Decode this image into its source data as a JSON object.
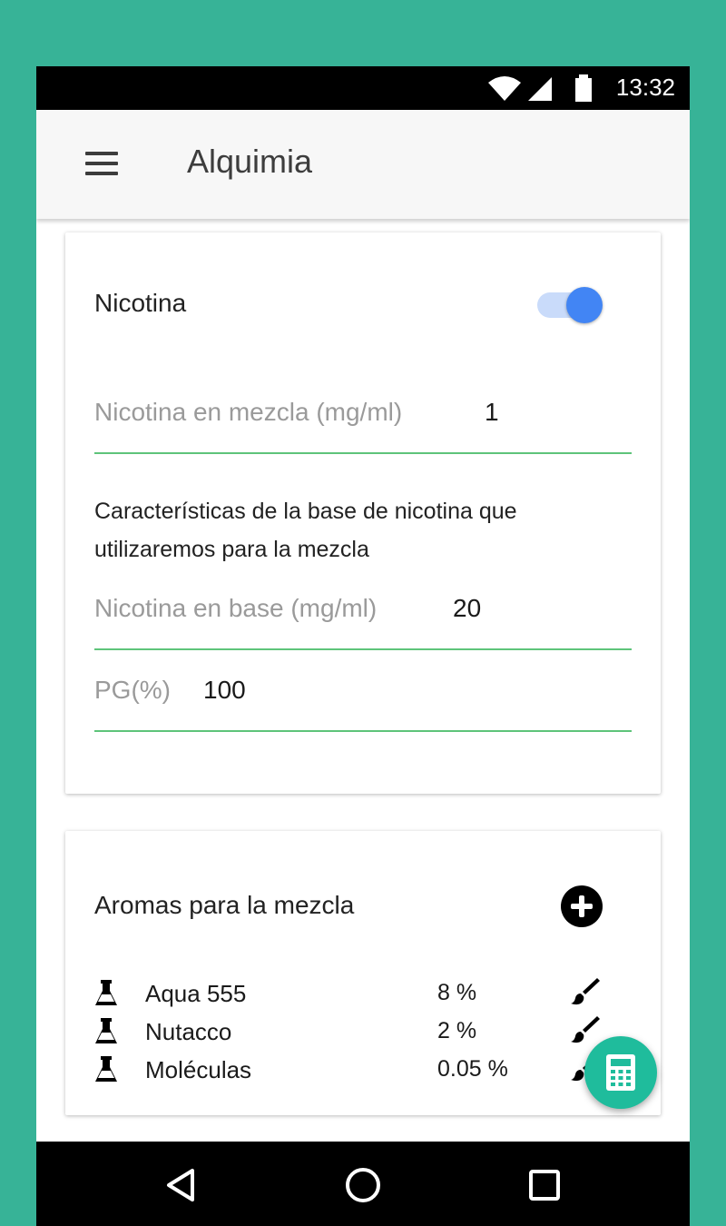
{
  "status_bar": {
    "time": "13:32"
  },
  "app_bar": {
    "title": "Alquimia"
  },
  "nicotina_card": {
    "title": "Nicotina",
    "toggle_on": true,
    "mix_field": {
      "label": "Nicotina en mezcla (mg/ml)",
      "value": "1"
    },
    "description": "Características de la base de nicotina que utilizaremos para la mezcla",
    "base_field": {
      "label": "Nicotina en base (mg/ml)",
      "value": "20"
    },
    "pg_field": {
      "label": "PG(%)",
      "value": "100"
    }
  },
  "aromas_card": {
    "title": "Aromas para la mezcla",
    "items": [
      {
        "name": "Aqua 555",
        "percent": "8 %"
      },
      {
        "name": "Nutacco",
        "percent": "2 %"
      },
      {
        "name": "Moléculas",
        "percent": "0.05 %"
      }
    ]
  },
  "colors": {
    "background": "#37b397",
    "accent_blue": "#4285f4",
    "field_underline": "#5ec47a",
    "fab": "#1fbc9c"
  },
  "icons": {
    "menu": "hamburger-menu-icon",
    "add": "plus-circle-icon",
    "flask": "flask-icon",
    "edit": "brush-icon",
    "fab": "calculator-icon",
    "nav_back": "triangle-back-icon",
    "nav_home": "circle-home-icon",
    "nav_recents": "square-recents-icon"
  }
}
